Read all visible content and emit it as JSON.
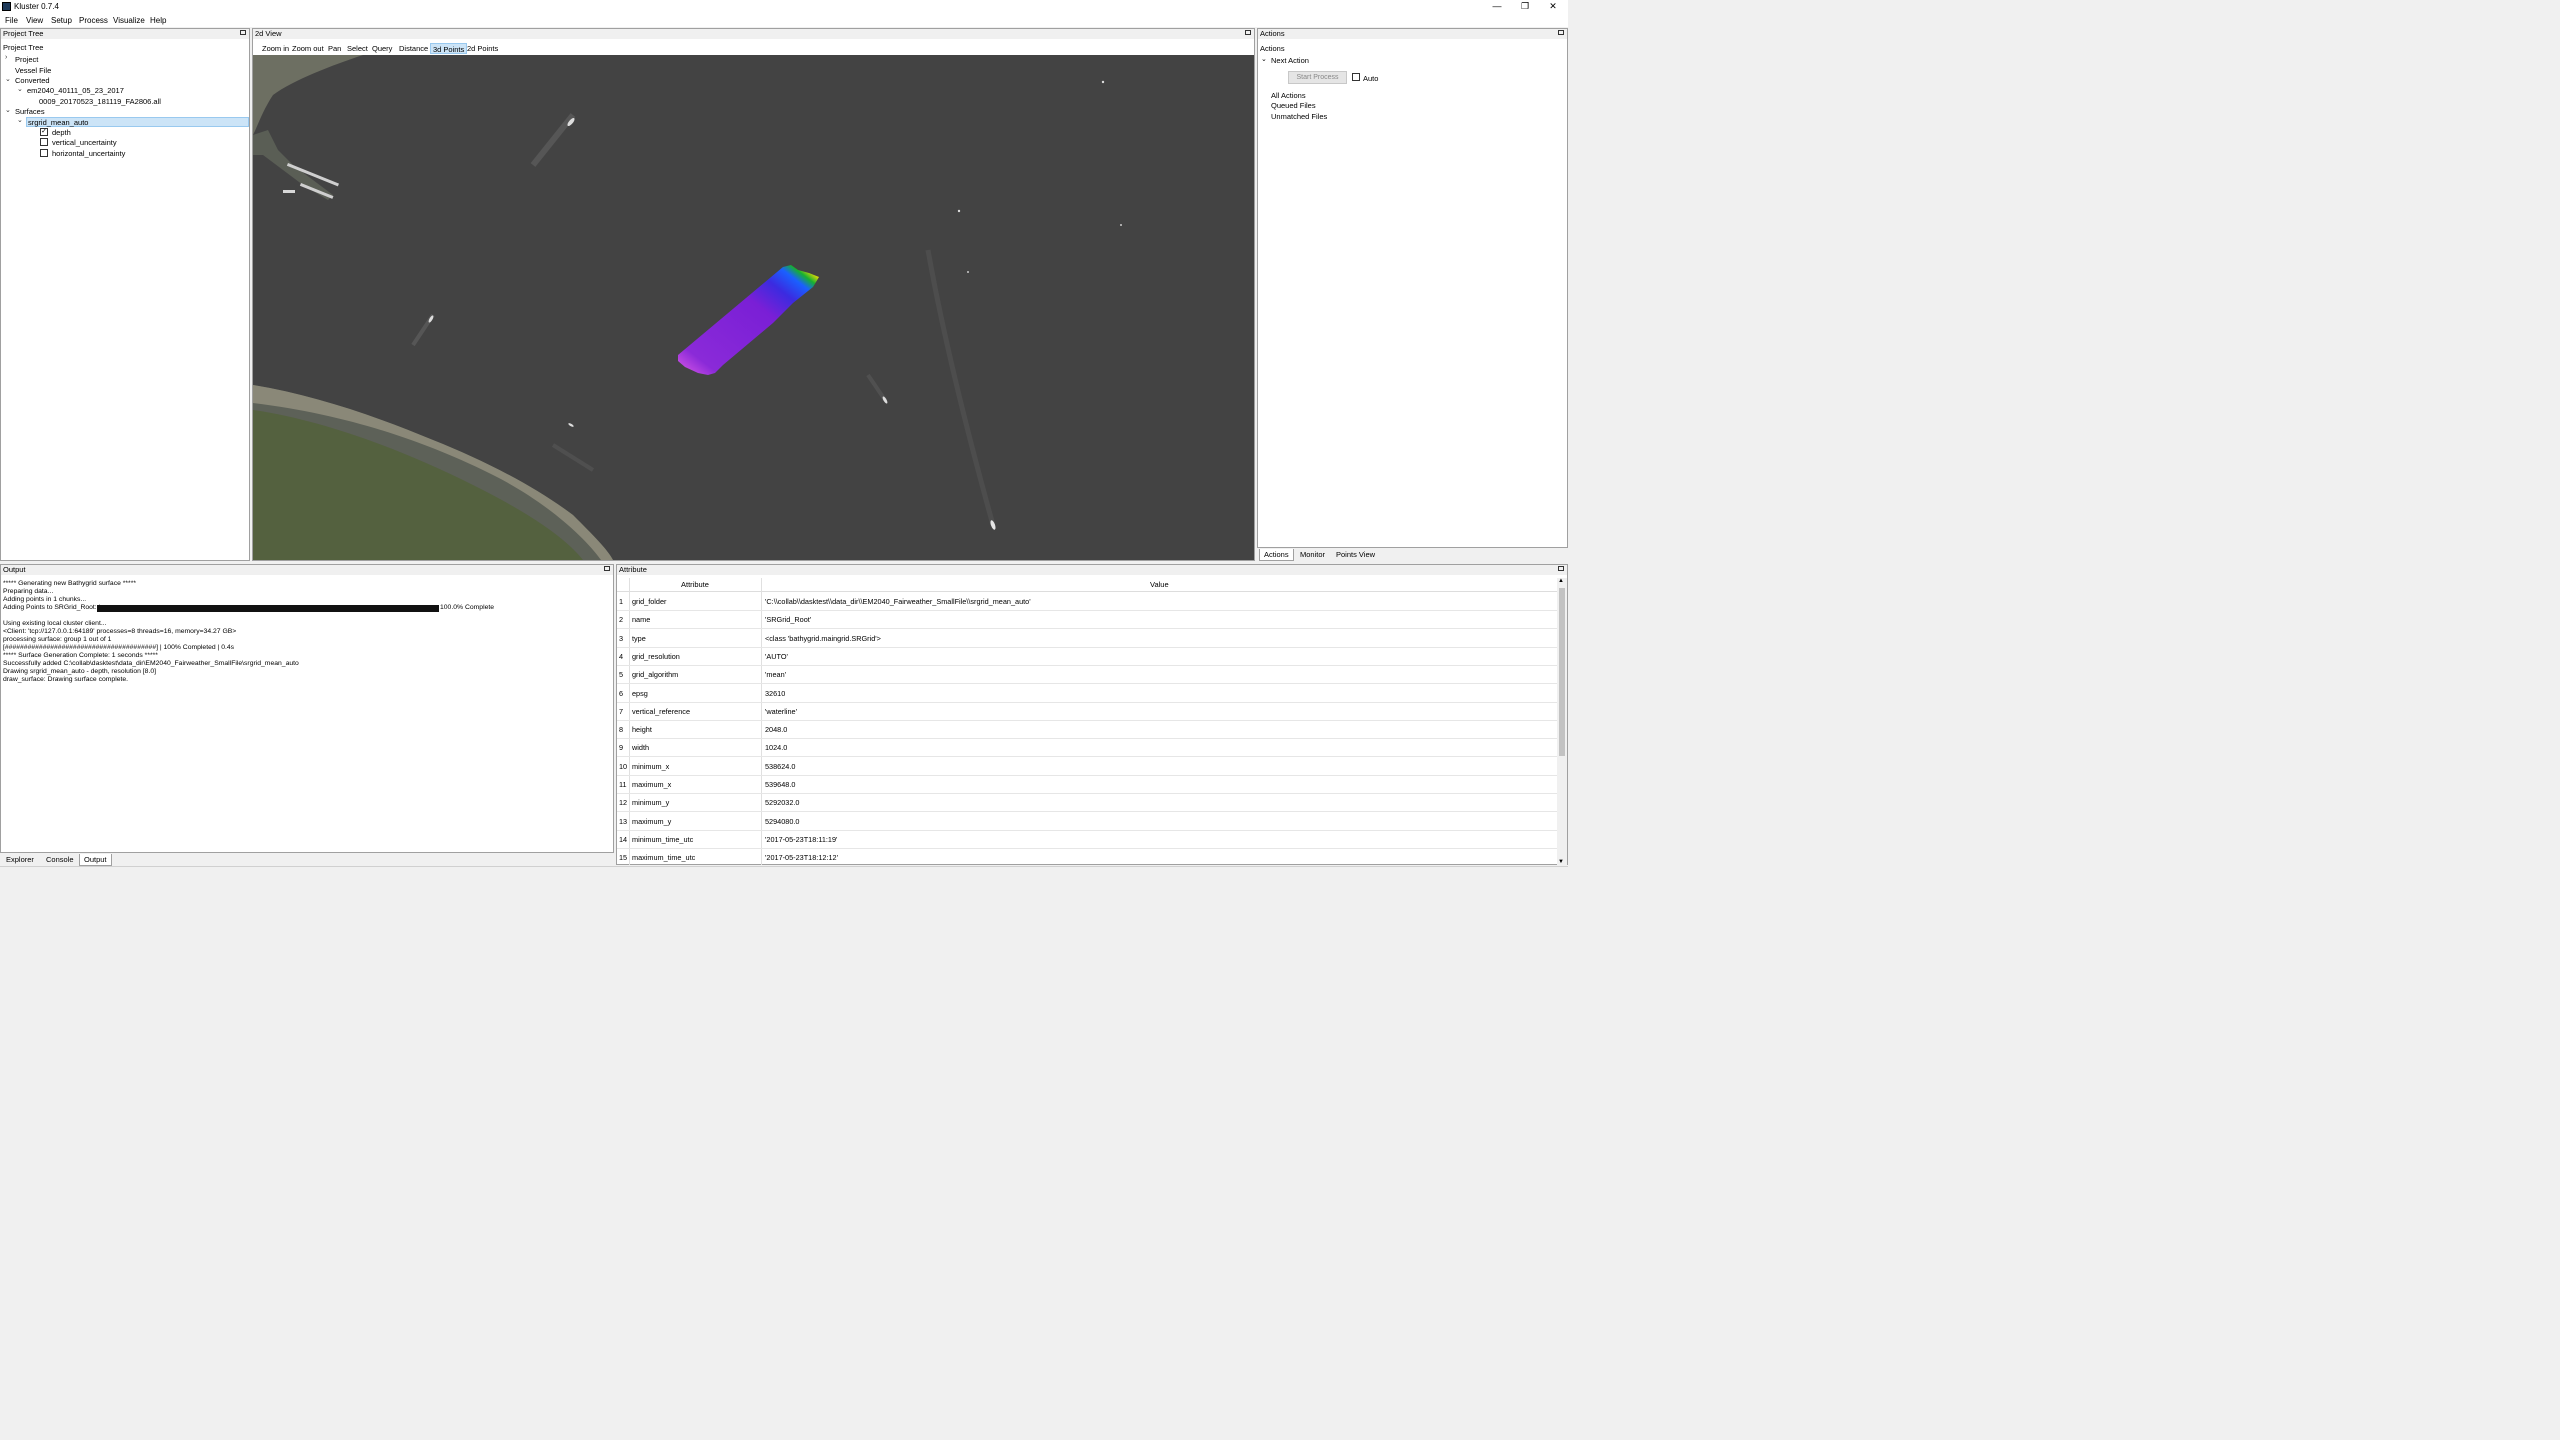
{
  "window": {
    "title": "Kluster 0.7.4"
  },
  "menu": [
    "File",
    "View",
    "Setup",
    "Process",
    "Visualize",
    "Help"
  ],
  "project_tree": {
    "panel_title": "Project Tree",
    "header": "Project Tree",
    "items": {
      "project": "Project",
      "vessel_file": "Vessel File",
      "converted": "Converted",
      "converted_child": "em2040_40111_05_23_2017",
      "converted_file": "0009_20170523_181119_FA2806.all",
      "surfaces": "Surfaces",
      "surface_name": "srgrid_mean_auto",
      "layers": [
        {
          "label": "depth",
          "checked": true,
          "check_glyph": "✓"
        },
        {
          "label": "vertical_uncertainty",
          "checked": false,
          "check_glyph": ""
        },
        {
          "label": "horizontal_uncertainty",
          "checked": false,
          "check_glyph": ""
        }
      ]
    }
  },
  "view2d": {
    "panel_title": "2d View",
    "tools": [
      "Zoom in",
      "Zoom out",
      "Pan",
      "Select",
      "Query",
      "Distance",
      "3d Points",
      "2d Points"
    ],
    "active_tool": "3d Points"
  },
  "actions": {
    "panel_title": "Actions",
    "header": "Actions",
    "next_action": "Next Action",
    "start_button": "Start Process",
    "auto_label": "Auto",
    "auto_checked": false,
    "lists": [
      "All Actions",
      "Queued Files",
      "Unmatched Files"
    ],
    "tabs": [
      "Actions",
      "Monitor",
      "Points View"
    ],
    "selected_tab": "Actions"
  },
  "output": {
    "panel_title": "Output",
    "lines": [
      "***** Generating new Bathygrid surface *****",
      "Preparing data...",
      "Adding points in 1 chunks...",
      "Adding Points to SRGrid_Root: |",
      "",
      "Using existing local cluster client...",
      "<Client: 'tcp://127.0.0.1:64189' processes=8 threads=16, memory=34.27 GB>",
      "processing surface: group 1 out of 1",
      "[########################################] | 100% Completed |  0.4s",
      "***** Surface Generation Complete: 1 seconds *****",
      "Successfully added C:\\collab\\dasktest\\data_dir\\EM2040_Fairweather_SmallFile\\srgrid_mean_auto",
      "Drawing srgrid_mean_auto - depth, resolution [8.0]",
      "draw_surface: Drawing surface complete."
    ],
    "progress_fraction": 1.0,
    "progress_text": "100.0% Complete",
    "tabs": [
      "Explorer",
      "Console",
      "Output"
    ],
    "selected_tab": "Output"
  },
  "attribute": {
    "panel_title": "Attribute",
    "columns": [
      "Attribute",
      "Value"
    ],
    "rows": [
      {
        "n": "1",
        "attr": "grid_folder",
        "value": "'C:\\\\collab\\\\dasktest\\\\data_dir\\\\EM2040_Fairweather_SmallFile\\\\srgrid_mean_auto'"
      },
      {
        "n": "2",
        "attr": "name",
        "value": "'SRGrid_Root'"
      },
      {
        "n": "3",
        "attr": "type",
        "value": "<class 'bathygrid.maingrid.SRGrid'>"
      },
      {
        "n": "4",
        "attr": "grid_resolution",
        "value": "'AUTO'"
      },
      {
        "n": "5",
        "attr": "grid_algorithm",
        "value": "'mean'"
      },
      {
        "n": "6",
        "attr": "epsg",
        "value": "32610"
      },
      {
        "n": "7",
        "attr": "vertical_reference",
        "value": "'waterline'"
      },
      {
        "n": "8",
        "attr": "height",
        "value": "2048.0"
      },
      {
        "n": "9",
        "attr": "width",
        "value": "1024.0"
      },
      {
        "n": "10",
        "attr": "minimum_x",
        "value": "538624.0"
      },
      {
        "n": "11",
        "attr": "maximum_x",
        "value": "539648.0"
      },
      {
        "n": "12",
        "attr": "minimum_y",
        "value": "5292032.0"
      },
      {
        "n": "13",
        "attr": "maximum_y",
        "value": "5294080.0"
      },
      {
        "n": "14",
        "attr": "minimum_time_utc",
        "value": "'2017-05-23T18:11:19'"
      },
      {
        "n": "15",
        "attr": "maximum_time_utc",
        "value": "'2017-05-23T18:12:12'"
      }
    ]
  },
  "colors": {
    "selection": "#cce4f7",
    "water": "#434343",
    "surface_low": "#7a1fd6",
    "surface_high": "#ffe000"
  }
}
